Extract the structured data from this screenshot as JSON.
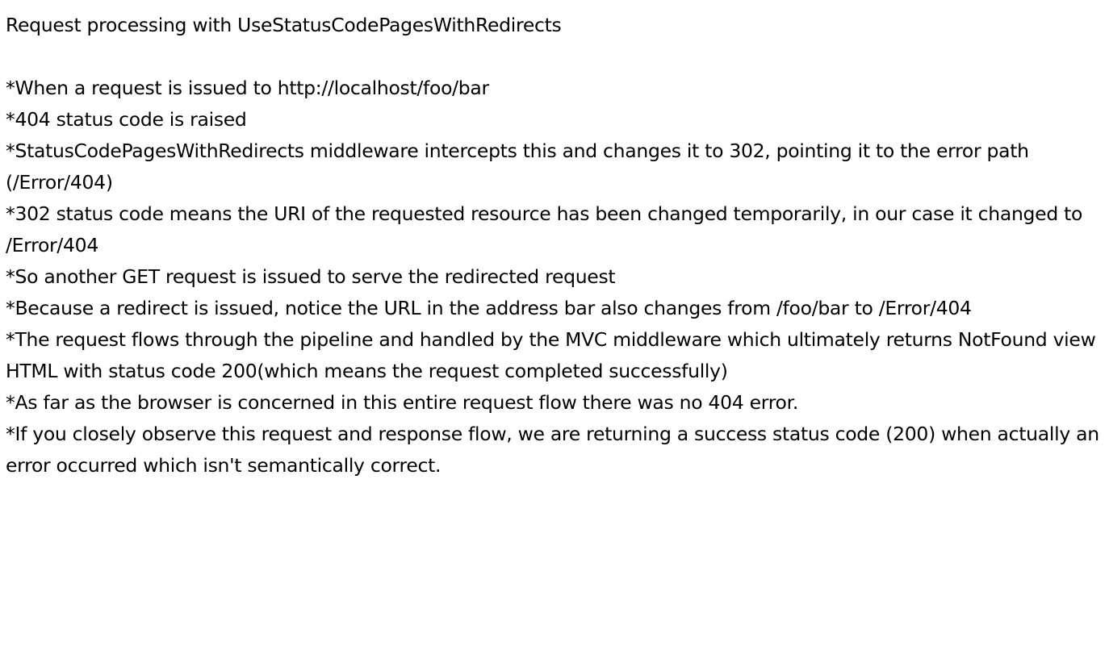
{
  "document": {
    "title": "Request processing with UseStatusCodePagesWithRedirects",
    "points": [
      "*When a request is issued to http://localhost/foo/bar",
      "*404 status code is raised",
      "*StatusCodePagesWithRedirects middleware intercepts this and changes it to 302, pointing it to the error path (/Error/404)",
      "*302 status code means the URI of the requested resource has been changed temporarily, in our case it changed to /Error/404",
      "*So another GET request is issued to serve the redirected request",
      "*Because a redirect is issued, notice the URL in the address bar also changes from /foo/bar to /Error/404",
      "*The request flows through the pipeline and handled by the MVC middleware which ultimately returns NotFound view HTML with status code 200(which means the request completed successfully)",
      "*As far as the browser is concerned in this entire request flow there was no 404 error.",
      "*If you closely observe this request and response flow, we are returning a success status code (200) when actually an error occurred which isn't semantically correct."
    ]
  }
}
